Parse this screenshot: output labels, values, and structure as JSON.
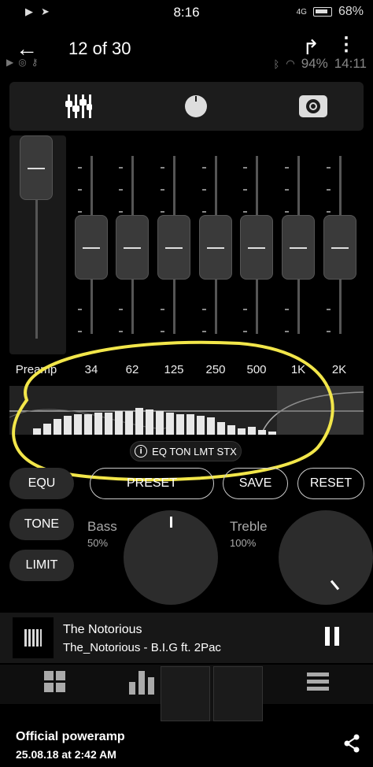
{
  "outer_status": {
    "time": "8:16",
    "battery": "68%",
    "network": "4G"
  },
  "viewer": {
    "title": "12 of 30"
  },
  "inner_status": {
    "battery": "94%",
    "time": "14:11"
  },
  "eq": {
    "preamp_label": "Preamp",
    "bands": [
      "34",
      "62",
      "125",
      "250",
      "500",
      "1K",
      "2K"
    ]
  },
  "spectrum_status": "EQ TON LMT STX",
  "buttons": {
    "equ": "EQU",
    "preset": "PRESET",
    "save": "SAVE",
    "reset": "RESET",
    "tone": "TONE",
    "limit": "LIMIT"
  },
  "knobs": {
    "bass_label": "Bass",
    "bass_value": "50%",
    "treble_label": "Treble",
    "treble_value": "100%"
  },
  "now_playing": {
    "title": "The Notorious",
    "subtitle": "The_Notorious - B.I.G ft. 2Pac"
  },
  "footer": {
    "name": "Official poweramp",
    "date": "25.08.18 at 2:42 AM"
  },
  "colors": {
    "highlight": "#f2e64a",
    "panel": "#1c1c1c"
  }
}
